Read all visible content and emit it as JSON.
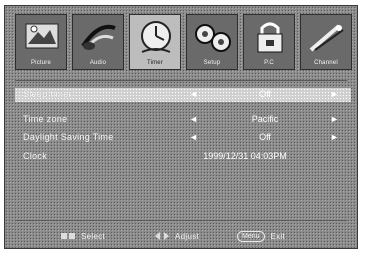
{
  "tabs": [
    {
      "label": "Picture",
      "icon": "picture-icon",
      "active": false
    },
    {
      "label": "Audio",
      "icon": "audio-icon",
      "active": false
    },
    {
      "label": "Timer",
      "icon": "timer-icon",
      "active": true
    },
    {
      "label": "Setup",
      "icon": "setup-icon",
      "active": false
    },
    {
      "label": "P.C",
      "icon": "pc-lock-icon",
      "active": false
    },
    {
      "label": "Channel",
      "icon": "channel-icon",
      "active": false
    }
  ],
  "menu": [
    {
      "label": "Sleep timer",
      "value": "Off"
    },
    {
      "label": "Time zone",
      "value": "Pacific"
    },
    {
      "label": "Daylight Saving Time",
      "value": "Off"
    },
    {
      "label": "Clock",
      "value": "1999/12/31 04:03PM"
    }
  ],
  "arrows": {
    "left": "◄",
    "right": "►"
  },
  "footer": {
    "select_label": "Select",
    "adjust_label": "Adjust",
    "menu_key": "Menu",
    "exit_label": "Exit"
  }
}
